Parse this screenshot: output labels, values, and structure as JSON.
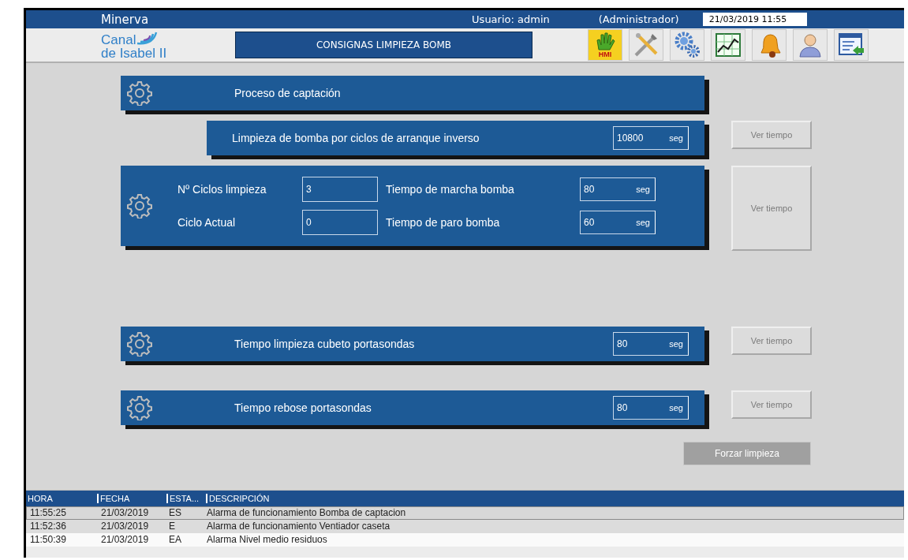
{
  "header": {
    "app_name": "Minerva",
    "user": "Usuario: admin",
    "role": "(Administrador)",
    "datetime": "21/03/2019 11:55"
  },
  "toolbar": {
    "logo_line1": "Canal",
    "logo_line2": "de Isabel II",
    "screen_title": "CONSIGNAS LIMPIEZA BOMB",
    "hmi_label": "HMI"
  },
  "panels": [
    {
      "kind": "title",
      "label": "Proceso de captación"
    },
    {
      "kind": "setting",
      "label": "Limpieza de bomba por ciclos de arranque inverso",
      "value": "10800",
      "unit": "seg",
      "button": {
        "label": "Ver tiempo",
        "disabled": true
      }
    },
    {
      "kind": "cycles",
      "fields": [
        {
          "label": "Nº Ciclos limpieza",
          "value": "3"
        },
        {
          "label": "Ciclo Actual",
          "value": "0"
        }
      ],
      "times": [
        {
          "label": "Tiempo de marcha bomba",
          "value": "80",
          "unit": "seg"
        },
        {
          "label": "Tiempo de paro bomba",
          "value": "60",
          "unit": "seg"
        }
      ],
      "button": {
        "label": "Ver tiempo",
        "disabled": true
      }
    },
    {
      "kind": "spacer"
    },
    {
      "kind": "gear_setting",
      "label": "Tiempo limpieza cubeto portasondas",
      "value": "80",
      "unit": "seg",
      "button": {
        "label": "Ver tiempo",
        "disabled": true
      }
    },
    {
      "kind": "gear_setting",
      "label": "Tiempo rebose portasondas",
      "value": "80",
      "unit": "seg",
      "button": {
        "label": "Ver tiempo",
        "disabled": true
      }
    }
  ],
  "force_button": {
    "label": "Forzar limpieza"
  },
  "alarms": {
    "columns": [
      "HORA",
      "FECHA",
      "ESTA...",
      "DESCRIPCIÓN"
    ],
    "rows": [
      {
        "hora": "11:55:25",
        "fecha": "21/03/2019",
        "estado": "ES",
        "descripcion": "Alarma de funcionamiento Bomba de captacion",
        "selected": true
      },
      {
        "hora": "11:52:36",
        "fecha": "21/03/2019",
        "estado": "E",
        "descripcion": "Alarma de funcionamiento Ventiador caseta",
        "selected": false
      },
      {
        "hora": "11:50:39",
        "fecha": "21/03/2019",
        "estado": "EA",
        "descripcion": "Alarma Nivel medio residuos",
        "selected": false
      }
    ]
  }
}
